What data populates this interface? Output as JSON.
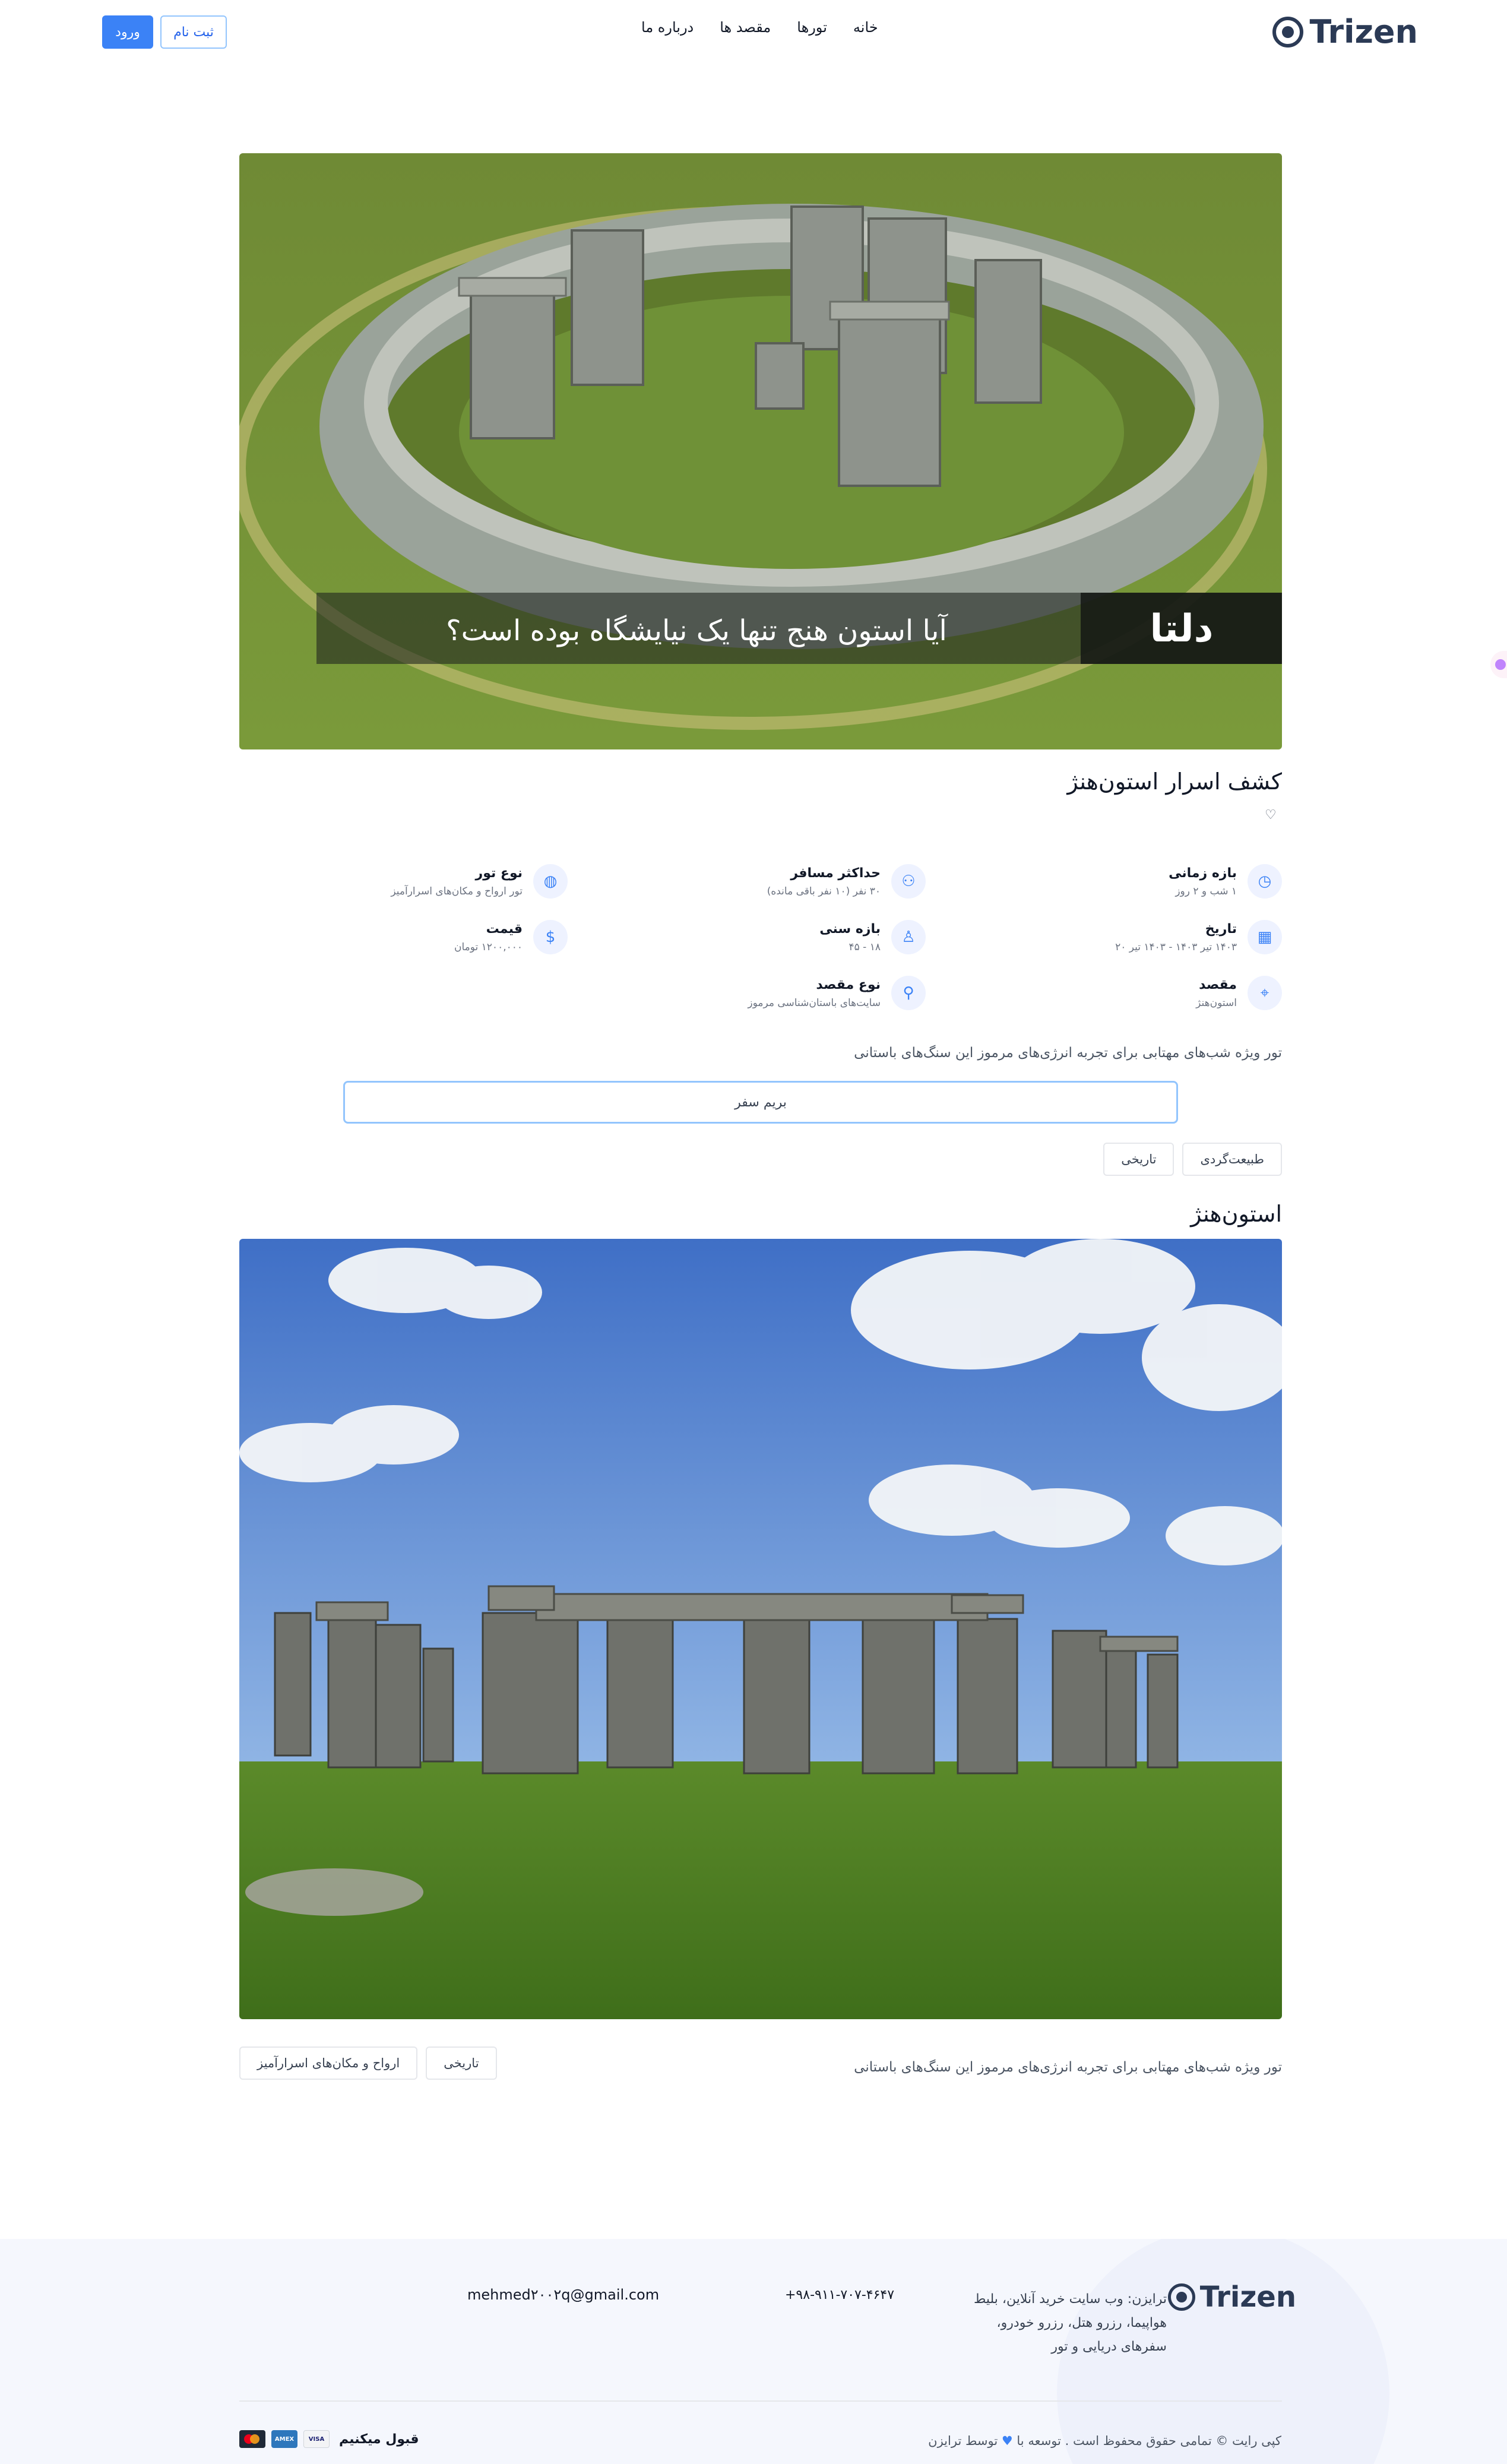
{
  "header": {
    "logo_text": "Trizen",
    "nav": [
      "خانه",
      "تورها",
      "مقصد ها",
      "درباره ما"
    ],
    "login_label": "ورود",
    "signup_label": "ثبت نام"
  },
  "hero": {
    "caption": "آیا استون هنج تنها یک نیایشگاه بوده است؟",
    "brand_mark": "دلتا"
  },
  "tour": {
    "title": "کشف اسرار استون‌هنژ",
    "info": [
      {
        "icon": "clock-icon",
        "label": "بازه زمانی",
        "value": "۱ شب و ۲ روز"
      },
      {
        "icon": "users-icon",
        "label": "حداکثر مسافر",
        "value": "۳۰ نفر (۱۰ نفر باقی مانده)"
      },
      {
        "icon": "globe-icon",
        "label": "نوع تور",
        "value": "تور ارواح و مکان‌های اسرارآمیز"
      },
      {
        "icon": "calendar-icon",
        "label": "تاریخ",
        "value": "۱۴۰۳ تیر ۱۴۰۳ - ۱۴۰۳ تیر ۲۰"
      },
      {
        "icon": "user-icon",
        "label": "بازه سنی",
        "value": "۱۸ - ۴۵"
      },
      {
        "icon": "dollar-icon",
        "label": "قیمت",
        "value": "۱۲۰۰,۰۰۰ تومان"
      },
      {
        "icon": "map-pin-icon",
        "label": "مقصد",
        "value": "استون‌هنژ"
      },
      {
        "icon": "pin-icon",
        "label": "نوع مقصد",
        "value": "سایت‌های باستان‌شناسی مرموز"
      }
    ],
    "description": "تور ویژه شب‌های مهتابی برای تجربه انرژی‌های مرموز این سنگ‌های باستانی",
    "cta_label": "بریم سفر",
    "tags": [
      "طبیعت‌گردی",
      "تاریخی"
    ]
  },
  "destination": {
    "title": "استون‌هنژ",
    "description": "تور ویژه شب‌های مهتابی برای تجربه انرژی‌های مرموز این سنگ‌های باستانی",
    "tags": [
      "تاریخی",
      "ارواح و مکان‌های اسرارآمیز"
    ]
  },
  "footer": {
    "logo_text": "Trizen",
    "about": "ترایزن: وب سایت خرید آنلاین، بلیط هواپیما، رزرو هتل، رزرو خودرو، سفرهای دریایی و تور",
    "phone": "+۹۸-۹۱۱-۷۰۷-۴۶۴۷",
    "email": "mehmed۲۰۰۲q@gmail.com",
    "copyright_prefix": "کپی رایت © تمامی حقوق محفوظ است . توسعه با",
    "copyright_suffix": "توسط ترایزن",
    "accept_label": "قبول میکنیم",
    "cards": [
      "VISA",
      "AMEX",
      "MC"
    ]
  }
}
